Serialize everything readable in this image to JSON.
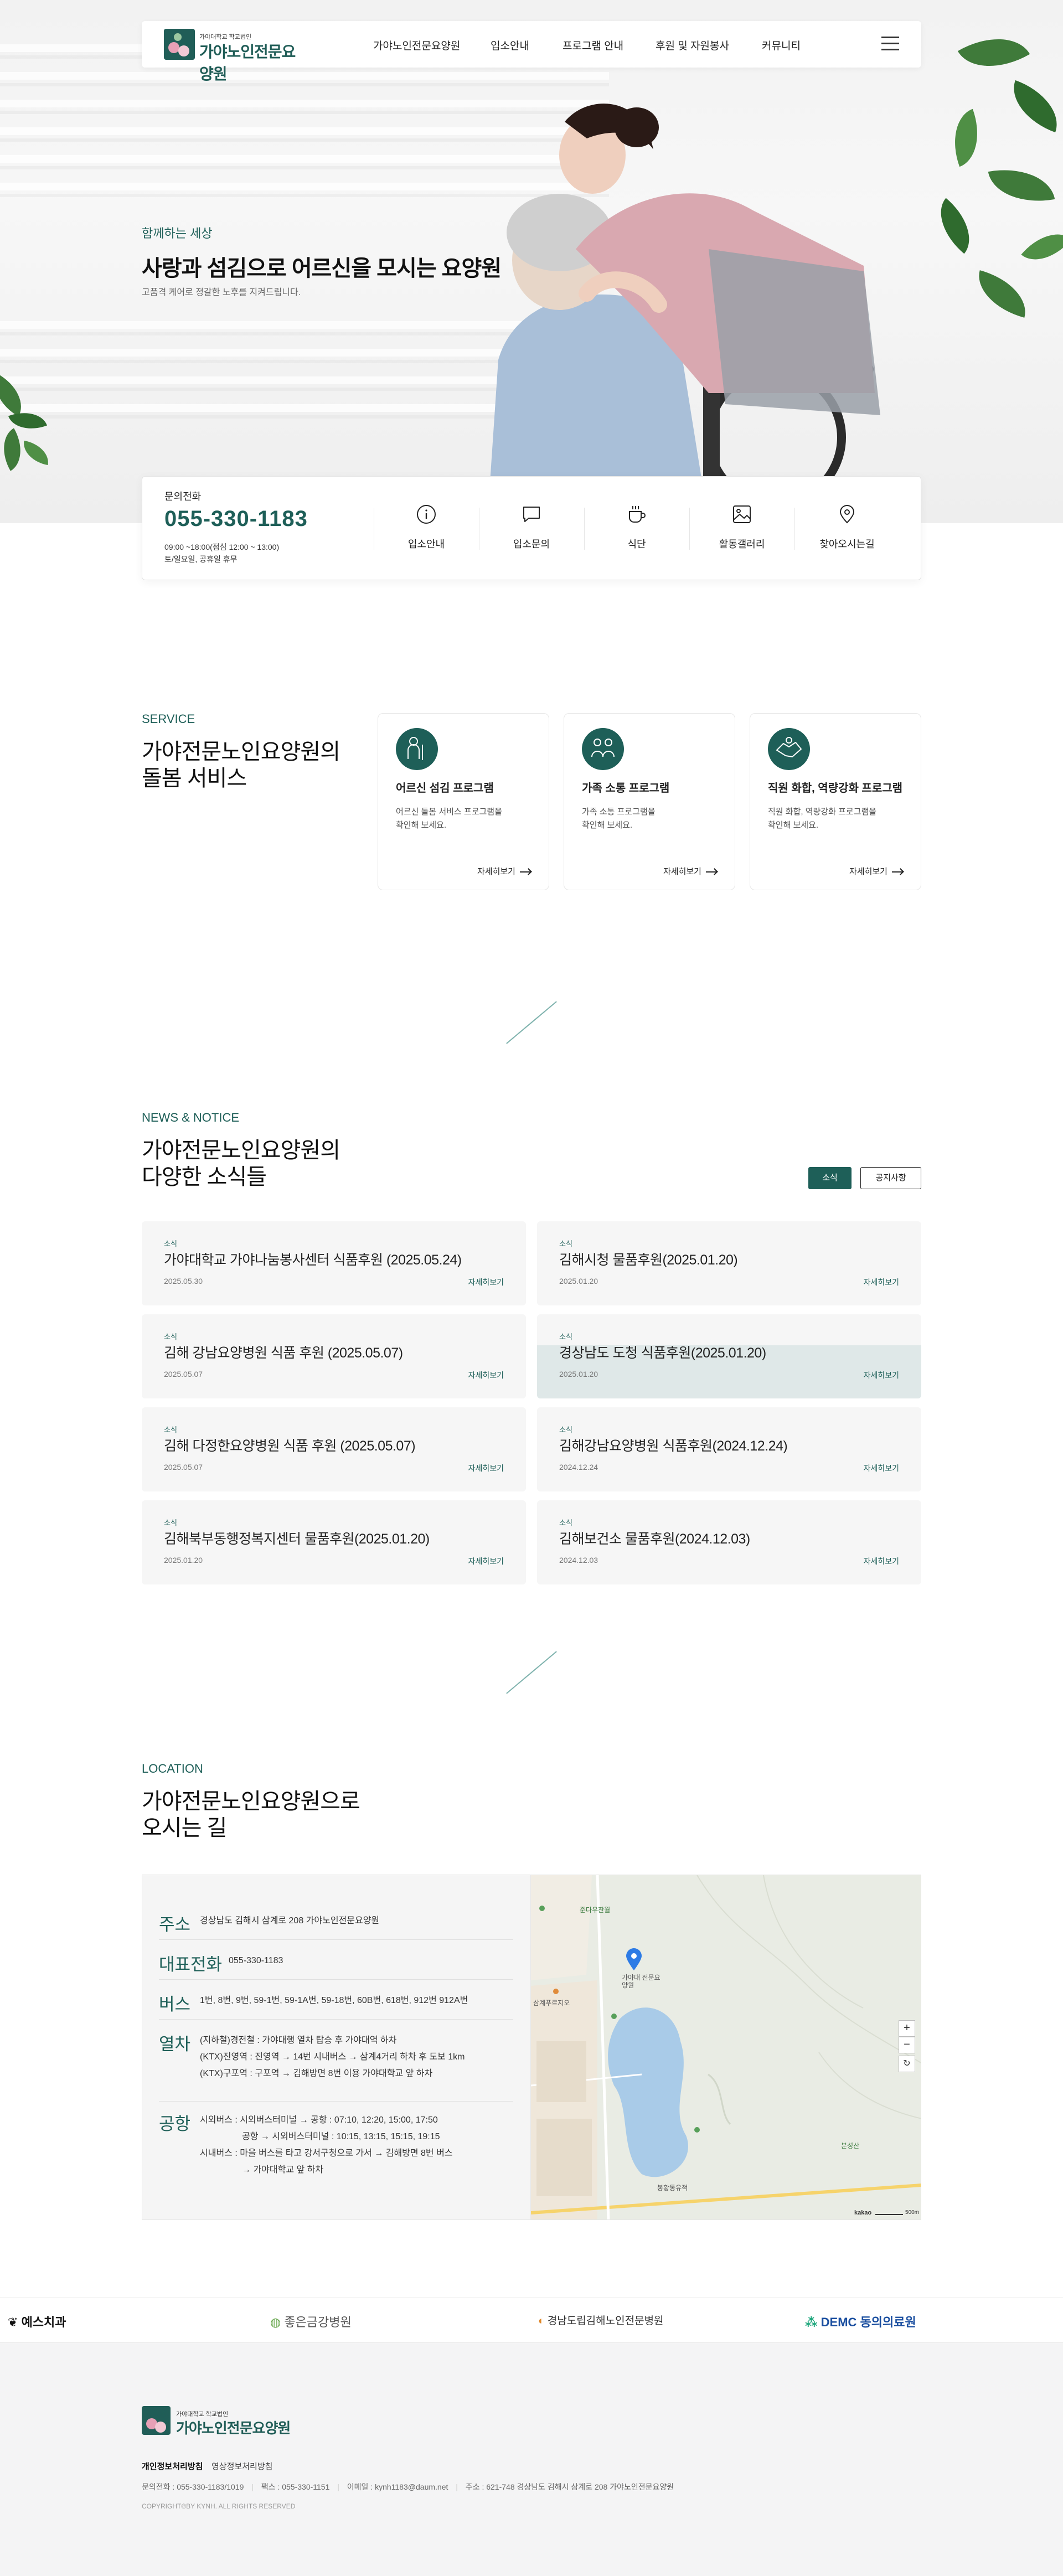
{
  "header": {
    "logo_sub": "가야대학교 학교법인",
    "logo_main": "가야노인전문요양원",
    "nav": [
      "가야노인전문요양원",
      "입소안내",
      "프로그램 안내",
      "후원 및 자원봉사",
      "커뮤니티"
    ]
  },
  "hero": {
    "subtitle": "함께하는 세상",
    "title": "사랑과 섬김으로 어르신을 모시는 요양원",
    "description": "고품격 케어로 정갈한 노후를 지켜드립니다."
  },
  "contact": {
    "label": "문의전화",
    "phone": "055-330-1183",
    "hours_line1": "09:00 ~18:00(점심 12:00 ~ 13:00)",
    "hours_line2": "토/일요일, 공휴일 휴무",
    "quick_links": [
      "입소안내",
      "입소문의",
      "식단",
      "활동갤러리",
      "찾아오시는길"
    ]
  },
  "service": {
    "eyebrow": "SERVICE",
    "title_line1": "가야전문노인요양원의",
    "title_line2": "돌봄 서비스",
    "more_label": "자세히보기",
    "cards": [
      {
        "name": "어르신 섬김 프로그램",
        "desc1": "어르신 돌봄 서비스 프로그램을",
        "desc2": "확인해 보세요."
      },
      {
        "name": "가족 소통 프로그램",
        "desc1": "가족 소통 프로그램을",
        "desc2": "확인해 보세요."
      },
      {
        "name": "직원 화합, 역량강화 프로그램",
        "desc1": "직원 화합, 역량강화 프로그램을",
        "desc2": "확인해 보세요."
      }
    ]
  },
  "news": {
    "eyebrow": "NEWS & NOTICE",
    "title_line1": "가야전문노인요양원의",
    "title_line2": "다양한 소식들",
    "tabs": [
      "소식",
      "공지사항"
    ],
    "more_label": "자세히보기",
    "items": [
      {
        "category": "소식",
        "title": "가야대학교 가야나눔봉사센터 식품후원 (2025.05.24)",
        "date": "2025.05.30"
      },
      {
        "category": "소식",
        "title": "김해시청 물품후원(2025.01.20)",
        "date": "2025.01.20"
      },
      {
        "category": "소식",
        "title": "김해 강남요양병원 식품 후원 (2025.05.07)",
        "date": "2025.05.07"
      },
      {
        "category": "소식",
        "title": "경상남도 도청 식품후원(2025.01.20)",
        "date": "2025.01.20"
      },
      {
        "category": "소식",
        "title": "김해 다정한요양병원 식품 후원 (2025.05.07)",
        "date": "2025.05.07"
      },
      {
        "category": "소식",
        "title": "김해강남요양병원 식품후원(2024.12.24)",
        "date": "2024.12.24"
      },
      {
        "category": "소식",
        "title": "김해북부동행정복지센터 물품후원(2025.01.20)",
        "date": "2025.01.20"
      },
      {
        "category": "소식",
        "title": "김해보건소 물품후원(2024.12.03)",
        "date": "2024.12.03"
      }
    ]
  },
  "location": {
    "eyebrow": "LOCATION",
    "title_line1": "가야전문노인요양원으로",
    "title_line2": "오시는 길",
    "address_label": "주소",
    "address": "경상남도 김해시 삼계로 208 가야노인전문요양원",
    "phone_label": "대표전화",
    "phone": "055-330-1183",
    "bus_label": "버스",
    "bus": "1번, 8번, 9번, 59-1번, 59-1A번, 59-18번, 60B번, 618번, 912번 912A번",
    "train_label": "열차",
    "train": [
      "(지하철)경전철 : 가야대행 열차 탑승 후 가야대역 하차",
      "(KTX)진영역 : 진영역 → 14번 시내버스 → 삼계4거리 하차 후 도보 1km",
      "(KTX)구포역 : 구포역 → 김해방면 8번 이용 가야대학교 앞 하차"
    ],
    "airport_label": "공항",
    "airport": [
      "시외버스 : 시외버스터미널 → 공항 : 07:10, 12:20, 15:00, 17:50",
      "공항 → 시외버스터미널 : 10:15, 13:15, 15:15, 19:15",
      "시내버스 : 마을 버스를 타고 강서구청으로 가서 → 김해방면 8번 버스",
      "→ 가야대학교 앞 하차"
    ],
    "map": {
      "labels": [
        "준다우잔월",
        "가야대 전문요양원",
        "삼계푸르지오",
        "분성산",
        "봉황동유적",
        "kakao",
        "500m"
      ],
      "zoom_in": "+",
      "zoom_out": "−",
      "reset": "↻"
    }
  },
  "partners": [
    "예스치과",
    "좋은금강병원",
    "경남도립김해노인전문병원",
    "DEMC 동의의료원"
  ],
  "footer": {
    "logo_sub": "가야대학교 학교법인",
    "logo_main": "가야노인전문요양원",
    "privacy": "개인정보처리방침",
    "video_policy": "영상정보처리방침",
    "info_phone": "문의전화 : 055-330-1183/1019",
    "info_fax": "팩스 : 055-330-1151",
    "info_email": "이메일 : kynh1183@daum.net",
    "info_address": "주소 : 621-748 경상남도 김해시 삼계로 208 가야노인전문요양원",
    "copyright": "COPYRIGHT©BY KYNH. ALL RIGHTS RESERVED"
  },
  "colors": {
    "brand": "#1e5f58",
    "accent": "#205d57",
    "card_bg": "#f6f6f6"
  }
}
